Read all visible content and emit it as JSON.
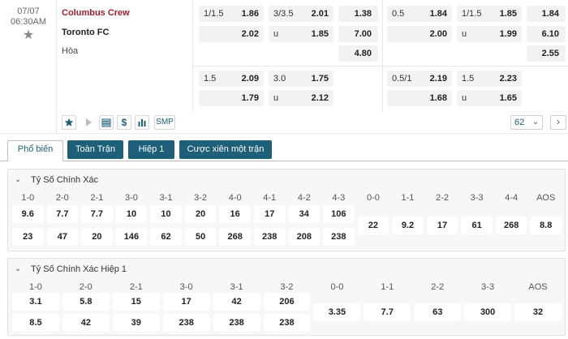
{
  "match": {
    "date": "07/07",
    "time": "06:30AM",
    "home_team": "Columbus Crew",
    "away_team": "Toronto FC",
    "draw_label": "Hòa",
    "ft": {
      "handicap": [
        {
          "h": "1/1.5",
          "v": "1.86"
        },
        {
          "h": "",
          "v": "2.02"
        }
      ],
      "overunder": [
        {
          "h": "3/3.5",
          "v": "2.01"
        },
        {
          "h": "u",
          "v": "1.85"
        }
      ],
      "x12": [
        "1.38",
        "7.00",
        "4.80"
      ]
    },
    "fh": {
      "handicap": [
        {
          "h": "0.5",
          "v": "1.84"
        },
        {
          "h": "",
          "v": "2.00"
        }
      ],
      "overunder": [
        {
          "h": "1/1.5",
          "v": "1.85"
        },
        {
          "h": "u",
          "v": "1.99"
        }
      ],
      "x12": [
        "1.84",
        "6.10",
        "2.55"
      ]
    },
    "ft2": {
      "handicap": [
        {
          "h": "1.5",
          "v": "2.09"
        },
        {
          "h": "",
          "v": "1.79"
        }
      ],
      "overunder": [
        {
          "h": "3.0",
          "v": "1.75"
        },
        {
          "h": "u",
          "v": "2.12"
        }
      ]
    },
    "fh2": {
      "handicap": [
        {
          "h": "0.5/1",
          "v": "2.19"
        },
        {
          "h": "",
          "v": "1.68"
        }
      ],
      "overunder": [
        {
          "h": "1.5",
          "v": "2.23"
        },
        {
          "h": "u",
          "v": "1.65"
        }
      ]
    },
    "icons": {
      "smp": "SMP"
    },
    "more_count": "62",
    "next": "›"
  },
  "tabs": [
    {
      "label": "Phổ biến"
    },
    {
      "label": "Toàn Trận"
    },
    {
      "label": "Hiệp 1"
    },
    {
      "label": "Cược xiên một trận"
    }
  ],
  "panels": {
    "correct_score": {
      "title": "Tỷ Số Chính Xác",
      "home_cols": [
        "1-0",
        "2-0",
        "2-1",
        "3-0",
        "3-1",
        "3-2",
        "4-0",
        "4-1",
        "4-2",
        "4-3"
      ],
      "home_row1": [
        "9.6",
        "7.7",
        "7.7",
        "10",
        "10",
        "20",
        "16",
        "17",
        "34",
        "106"
      ],
      "home_row2": [
        "23",
        "47",
        "20",
        "146",
        "62",
        "50",
        "268",
        "238",
        "208",
        "238"
      ],
      "draw_cols": [
        "0-0",
        "1-1",
        "2-2",
        "3-3",
        "4-4",
        "AOS"
      ],
      "draw_vals": [
        "22",
        "9.2",
        "17",
        "61",
        "268",
        "8.8"
      ]
    },
    "correct_score_1h": {
      "title": "Tỷ Số Chính Xác Hiệp 1",
      "home_cols": [
        "1-0",
        "2-0",
        "2-1",
        "3-0",
        "3-1",
        "3-2"
      ],
      "home_row1": [
        "3.1",
        "5.8",
        "15",
        "17",
        "42",
        "206"
      ],
      "home_row2": [
        "8.5",
        "42",
        "39",
        "238",
        "238",
        "238"
      ],
      "draw_cols": [
        "0-0",
        "1-1",
        "2-2",
        "3-3",
        "AOS"
      ],
      "draw_vals": [
        "3.35",
        "7.7",
        "63",
        "300",
        "32"
      ]
    }
  }
}
